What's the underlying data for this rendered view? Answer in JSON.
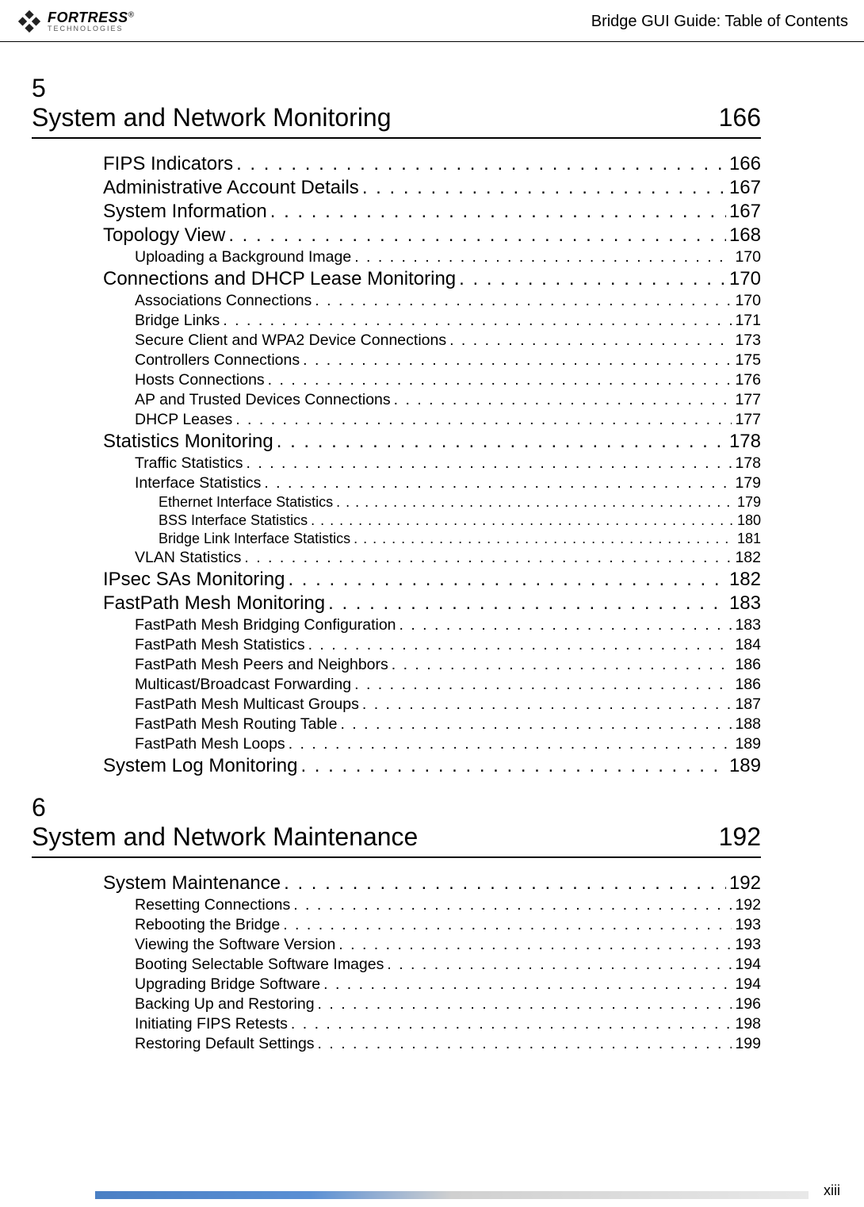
{
  "header": {
    "logo_main": "FORTRESS",
    "logo_reg": "®",
    "logo_sub": "TECHNOLOGIES",
    "title": "Bridge GUI Guide: Table of Contents"
  },
  "chapters": [
    {
      "num": "5",
      "title": "System and Network Monitoring",
      "page": "166",
      "entries": [
        {
          "level": 1,
          "label": "FIPS Indicators",
          "page": "166"
        },
        {
          "level": 1,
          "label": "Administrative Account Details",
          "page": "167"
        },
        {
          "level": 1,
          "label": "System Information",
          "page": "167"
        },
        {
          "level": 1,
          "label": "Topology View",
          "page": "168"
        },
        {
          "level": 2,
          "label": "Uploading a Background Image",
          "page": "170"
        },
        {
          "level": 1,
          "label": "Connections and DHCP Lease Monitoring",
          "page": "170"
        },
        {
          "level": 2,
          "label": "Associations Connections",
          "page": "170"
        },
        {
          "level": 2,
          "label": "Bridge Links",
          "page": "171"
        },
        {
          "level": 2,
          "label": "Secure Client and WPA2 Device Connections",
          "page": "173"
        },
        {
          "level": 2,
          "label": "Controllers Connections",
          "page": "175"
        },
        {
          "level": 2,
          "label": "Hosts Connections",
          "page": "176"
        },
        {
          "level": 2,
          "label": "AP and Trusted Devices Connections",
          "page": "177"
        },
        {
          "level": 2,
          "label": "DHCP Leases",
          "page": "177"
        },
        {
          "level": 1,
          "label": "Statistics Monitoring",
          "page": "178"
        },
        {
          "level": 2,
          "label": "Traffic Statistics",
          "page": "178"
        },
        {
          "level": 2,
          "label": "Interface Statistics",
          "page": "179"
        },
        {
          "level": 3,
          "label": "Ethernet Interface Statistics",
          "page": "179"
        },
        {
          "level": 3,
          "label": "BSS Interface Statistics",
          "page": "180"
        },
        {
          "level": 3,
          "label": "Bridge Link Interface Statistics",
          "page": "181"
        },
        {
          "level": 2,
          "label": "VLAN Statistics",
          "page": "182"
        },
        {
          "level": 1,
          "label": "IPsec SAs Monitoring",
          "page": "182"
        },
        {
          "level": 1,
          "label": "FastPath Mesh Monitoring",
          "page": "183"
        },
        {
          "level": 2,
          "label": "FastPath Mesh Bridging Configuration",
          "page": "183"
        },
        {
          "level": 2,
          "label": "FastPath Mesh Statistics",
          "page": "184"
        },
        {
          "level": 2,
          "label": "FastPath Mesh Peers and Neighbors",
          "page": "186"
        },
        {
          "level": 2,
          "label": "Multicast/Broadcast Forwarding",
          "page": "186"
        },
        {
          "level": 2,
          "label": "FastPath Mesh Multicast Groups",
          "page": "187"
        },
        {
          "level": 2,
          "label": "FastPath Mesh Routing Table",
          "page": "188"
        },
        {
          "level": 2,
          "label": "FastPath Mesh Loops",
          "page": "189"
        },
        {
          "level": 1,
          "label": "System Log Monitoring",
          "page": "189"
        }
      ]
    },
    {
      "num": "6",
      "title": "System and Network Maintenance",
      "page": "192",
      "entries": [
        {
          "level": 1,
          "label": "System Maintenance",
          "page": "192"
        },
        {
          "level": 2,
          "label": "Resetting Connections",
          "page": "192"
        },
        {
          "level": 2,
          "label": "Rebooting the Bridge",
          "page": "193"
        },
        {
          "level": 2,
          "label": "Viewing the Software Version",
          "page": "193"
        },
        {
          "level": 2,
          "label": "Booting Selectable Software Images",
          "page": "194"
        },
        {
          "level": 2,
          "label": "Upgrading Bridge Software",
          "page": "194"
        },
        {
          "level": 2,
          "label": "Backing Up and Restoring",
          "page": "196"
        },
        {
          "level": 2,
          "label": "Initiating FIPS Retests",
          "page": "198"
        },
        {
          "level": 2,
          "label": "Restoring Default Settings",
          "page": "199"
        }
      ]
    }
  ],
  "footer": {
    "page_num": "xiii"
  }
}
